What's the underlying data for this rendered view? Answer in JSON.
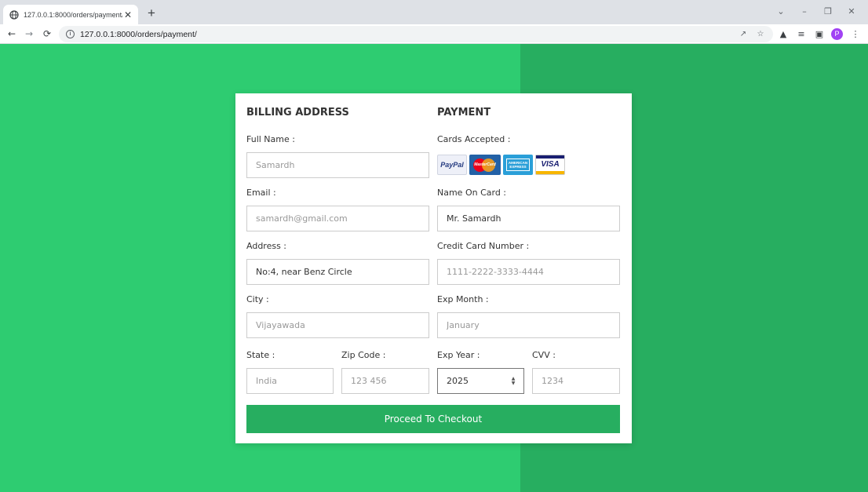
{
  "browser": {
    "tab_title": "127.0.0.1:8000/orders/payment/",
    "tab_close": "✕",
    "new_tab": "+",
    "url": "127.0.0.1:8000/orders/payment/",
    "profile_initial": "P"
  },
  "billing": {
    "title": "BILLING ADDRESS",
    "full_name_label": "Full Name :",
    "full_name_placeholder": "Samardh",
    "email_label": "Email :",
    "email_placeholder": "samardh@gmail.com",
    "address_label": "Address :",
    "address_value": "No:4, near Benz Circle",
    "city_label": "City :",
    "city_placeholder": "Vijayawada",
    "state_label": "State :",
    "state_placeholder": "India",
    "zip_label": "Zip Code :",
    "zip_placeholder": "123 456"
  },
  "payment": {
    "title": "PAYMENT",
    "cards_label": "Cards Accepted :",
    "card_logos": {
      "paypal": "PayPal",
      "mastercard": "MasterCard",
      "amex": "AMERICAN EXPRESS",
      "visa": "VISA"
    },
    "name_on_card_label": "Name On Card :",
    "name_on_card_value": "Mr. Samardh",
    "card_number_label": "Credit Card Number :",
    "card_number_placeholder": "1111-2222-3333-4444",
    "exp_month_label": "Exp Month :",
    "exp_month_placeholder": "January",
    "exp_year_label": "Exp Year :",
    "exp_year_value": "2025",
    "cvv_label": "CVV :",
    "cvv_placeholder": "1234"
  },
  "submit_label": "Proceed To Checkout",
  "colors": {
    "page_left": "#2ecc71",
    "page_right": "#27ae60",
    "button": "#27ae60"
  }
}
